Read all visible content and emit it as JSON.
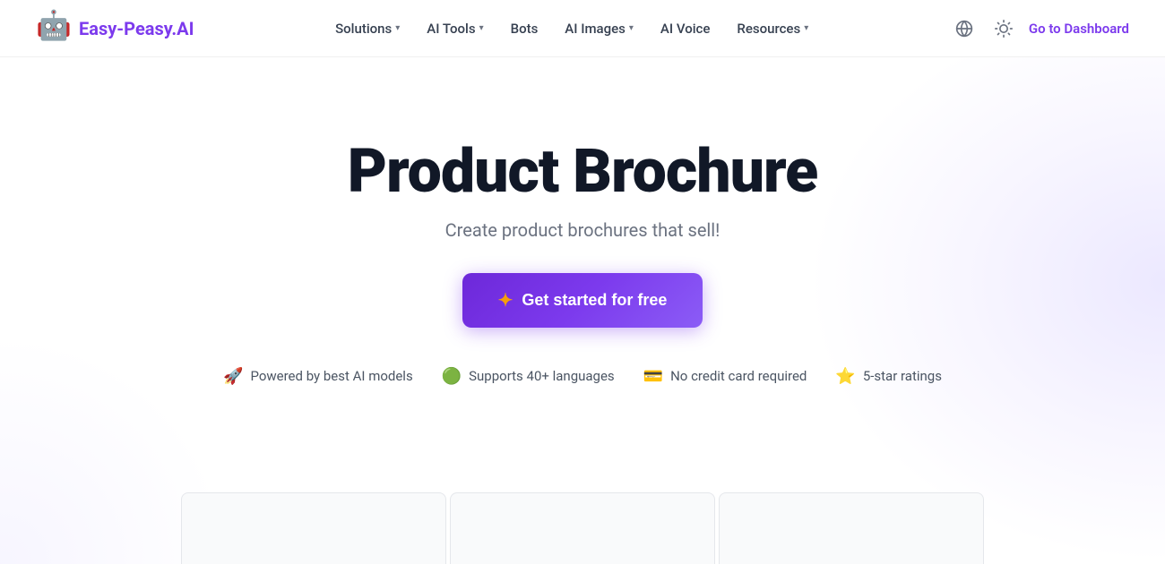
{
  "logo": {
    "icon": "🤖",
    "text_before": "Easy-Peasy",
    "text_after": ".AI"
  },
  "nav": {
    "items": [
      {
        "label": "Solutions",
        "has_dropdown": true
      },
      {
        "label": "AI Tools",
        "has_dropdown": true
      },
      {
        "label": "Bots",
        "has_dropdown": false
      },
      {
        "label": "AI Images",
        "has_dropdown": true
      },
      {
        "label": "AI Voice",
        "has_dropdown": false
      },
      {
        "label": "Resources",
        "has_dropdown": true
      }
    ]
  },
  "actions": {
    "globe_icon": "🌐",
    "theme_icon": "☀",
    "dashboard_label": "Go to Dashboard"
  },
  "hero": {
    "title": "Product Brochure",
    "subtitle": "Create product brochures that sell!",
    "cta_label": "Get started for free",
    "cta_icon": "✦"
  },
  "features": [
    {
      "icon": "🚀",
      "label": "Powered by best AI models"
    },
    {
      "icon": "🟢",
      "label": "Supports 40+ languages"
    },
    {
      "icon": "💳",
      "label": "No credit card required"
    },
    {
      "icon": "⭐",
      "label": "5-star ratings"
    }
  ],
  "colors": {
    "brand": "#7c3aed",
    "cta_bg": "#7c3aed",
    "logo_text": "#2d1b69"
  }
}
